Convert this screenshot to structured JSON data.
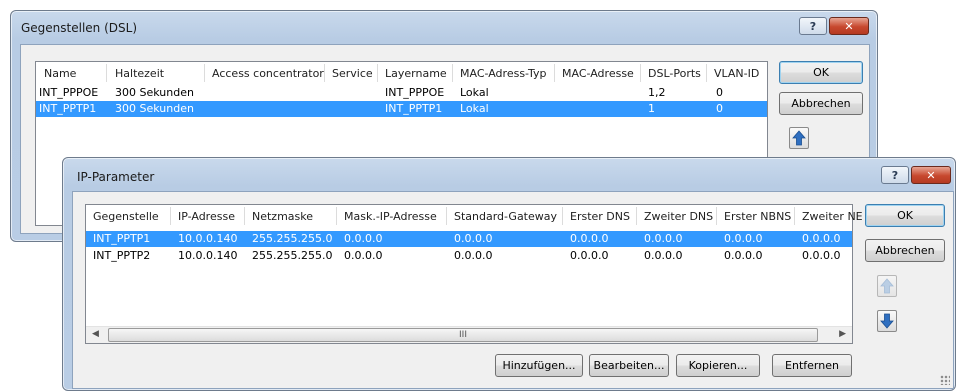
{
  "dsl_dialog": {
    "title": "Gegenstellen (DSL)",
    "help_label": "?",
    "close_label": "✕",
    "columns": [
      "Name",
      "Haltezeit",
      "Access concentrator",
      "Service",
      "Layername",
      "MAC-Adress-Typ",
      "MAC-Adresse",
      "DSL-Ports",
      "VLAN-ID"
    ],
    "rows": [
      {
        "name": "INT_PPPOE",
        "haltezeit": "300 Sekunden",
        "ac": "",
        "service": "",
        "layer": "INT_PPPOE",
        "mactyp": "Lokal",
        "mac": "",
        "ports": "1,2",
        "vlan": "0"
      },
      {
        "name": "INT_PPTP1",
        "haltezeit": "300 Sekunden",
        "ac": "",
        "service": "",
        "layer": "INT_PPTP1",
        "mactyp": "Lokal",
        "mac": "",
        "ports": "1",
        "vlan": "0"
      }
    ],
    "ok_label": "OK",
    "cancel_label": "Abbrechen"
  },
  "ip_dialog": {
    "title": "IP-Parameter",
    "help_label": "?",
    "close_label": "✕",
    "columns": [
      "Gegenstelle",
      "IP-Adresse",
      "Netzmaske",
      "Mask.-IP-Adresse",
      "Standard-Gateway",
      "Erster DNS",
      "Zweiter DNS",
      "Erster NBNS",
      "Zweiter NE"
    ],
    "rows": [
      {
        "gegenstelle": "INT_PPTP1",
        "ip": "10.0.0.140",
        "mask": "255.255.255.0",
        "maskip": "0.0.0.0",
        "gw": "0.0.0.0",
        "dns1": "0.0.0.0",
        "dns2": "0.0.0.0",
        "nbns1": "0.0.0.0",
        "nbns2": "0.0.0.0"
      },
      {
        "gegenstelle": "INT_PPTP2",
        "ip": "10.0.0.140",
        "mask": "255.255.255.0",
        "maskip": "0.0.0.0",
        "gw": "0.0.0.0",
        "dns1": "0.0.0.0",
        "dns2": "0.0.0.0",
        "nbns1": "0.0.0.0",
        "nbns2": "0.0.0.0"
      }
    ],
    "scroll_thumb_glyph": "III",
    "ok_label": "OK",
    "cancel_label": "Abbrechen",
    "add_label": "Hinzufügen...",
    "edit_label": "Bearbeiten...",
    "copy_label": "Kopieren...",
    "remove_label": "Entfernen"
  },
  "colors": {
    "selection": "#3399ff",
    "frame": "#b9cde5",
    "arrow": "#2f6fc0"
  }
}
